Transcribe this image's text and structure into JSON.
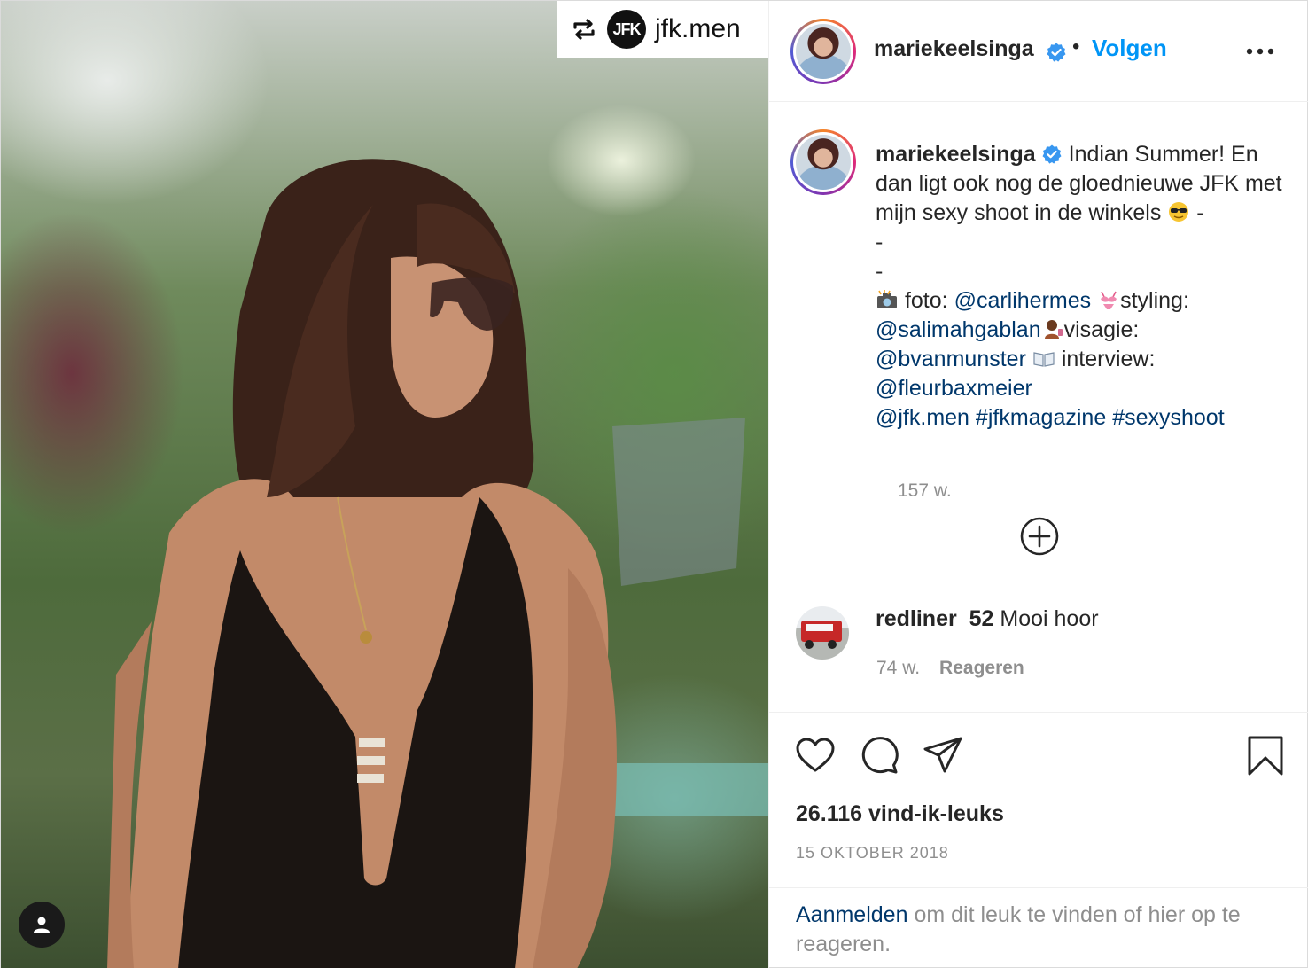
{
  "media": {
    "repost_badge": {
      "logo_text": "JFK",
      "account": "jfk.men"
    }
  },
  "header": {
    "username": "mariekeelsinga",
    "separator": "•",
    "follow_label": "Volgen"
  },
  "caption": {
    "username": "mariekeelsinga",
    "text_line1": "Indian Summer! En dan ligt ook nog de gloednieuwe JFK met mijn sexy shoot in de winkels",
    "dash1": "-",
    "dash2": "-",
    "dash3": "-",
    "foto_label": "foto:",
    "foto_mention": "@carlihermes",
    "styling_label": "styling:",
    "styling_mention": "@salimahgablan",
    "visagie_label": "visagie:",
    "visagie_mention": "@bvanmunster",
    "interview_label": "interview:",
    "interview_mention": "@fleurbaxmeier",
    "mention_jfk": "@jfk.men",
    "hashtag1": "#jfkmagazine",
    "hashtag2": "#sexyshoot",
    "time": "157 w."
  },
  "comment": {
    "username": "redliner_52",
    "text": "Mooi hoor",
    "time": "74 w.",
    "reply_label": "Reageren"
  },
  "actions": {
    "likes": "26.116 vind-ik-leuks",
    "date": "15 OKTOBER 2018"
  },
  "login_bar": {
    "link": "Aanmelden",
    "text": "om dit leuk te vinden of hier op te reageren."
  },
  "colors": {
    "accent": "#0095f6",
    "link": "#00376b",
    "muted": "#8e8e8e",
    "verified": "#3897f0"
  }
}
